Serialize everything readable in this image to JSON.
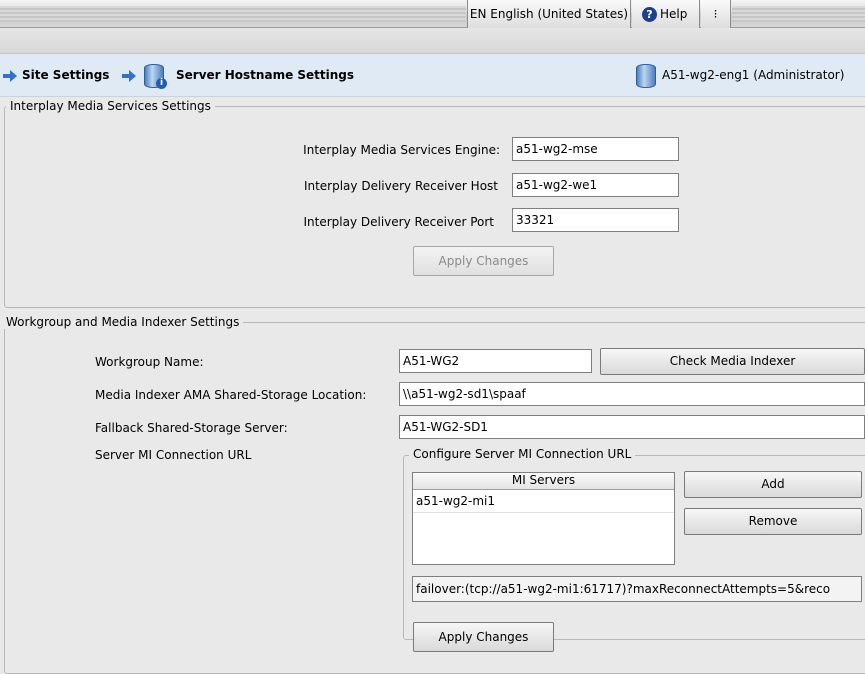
{
  "topbar": {
    "language": "EN English (United States)",
    "help": "Help",
    "menu_glyph": "⁝"
  },
  "breadcrumb": {
    "items": [
      "Site Settings",
      "Server Hostname Settings"
    ],
    "user": "A51-wg2-eng1 (Administrator)"
  },
  "interplay": {
    "legend": "Interplay Media Services Settings",
    "fields": [
      {
        "label": "Interplay Media Services Engine:",
        "value": "a51-wg2-mse"
      },
      {
        "label": "Interplay Delivery Receiver Host",
        "value": "a51-wg2-we1"
      },
      {
        "label": "Interplay Delivery Receiver Port",
        "value": "33321"
      }
    ],
    "apply_label": "Apply Changes"
  },
  "workgroup": {
    "legend": "Workgroup and Media Indexer Settings",
    "fields": [
      {
        "label": "Workgroup Name:",
        "value": "A51-WG2"
      },
      {
        "label": "Media Indexer AMA Shared-Storage Location:",
        "value": "\\\\a51-wg2-sd1\\spaaf"
      },
      {
        "label": "Fallback Shared-Storage Server:",
        "value": "A51-WG2-SD1"
      }
    ],
    "check_label": "Check Media Indexer",
    "url_label": "Server MI Connection URL",
    "configure_legend": "Configure Server MI Connection URL",
    "mi_header": "MI Servers",
    "mi_servers": [
      "a51-wg2-mi1"
    ],
    "add_label": "Add",
    "remove_label": "Remove",
    "connection_url": "failover:(tcp://a51-wg2-mi1:61717)?maxReconnectAttempts=5&reco",
    "apply_label": "Apply Changes"
  }
}
